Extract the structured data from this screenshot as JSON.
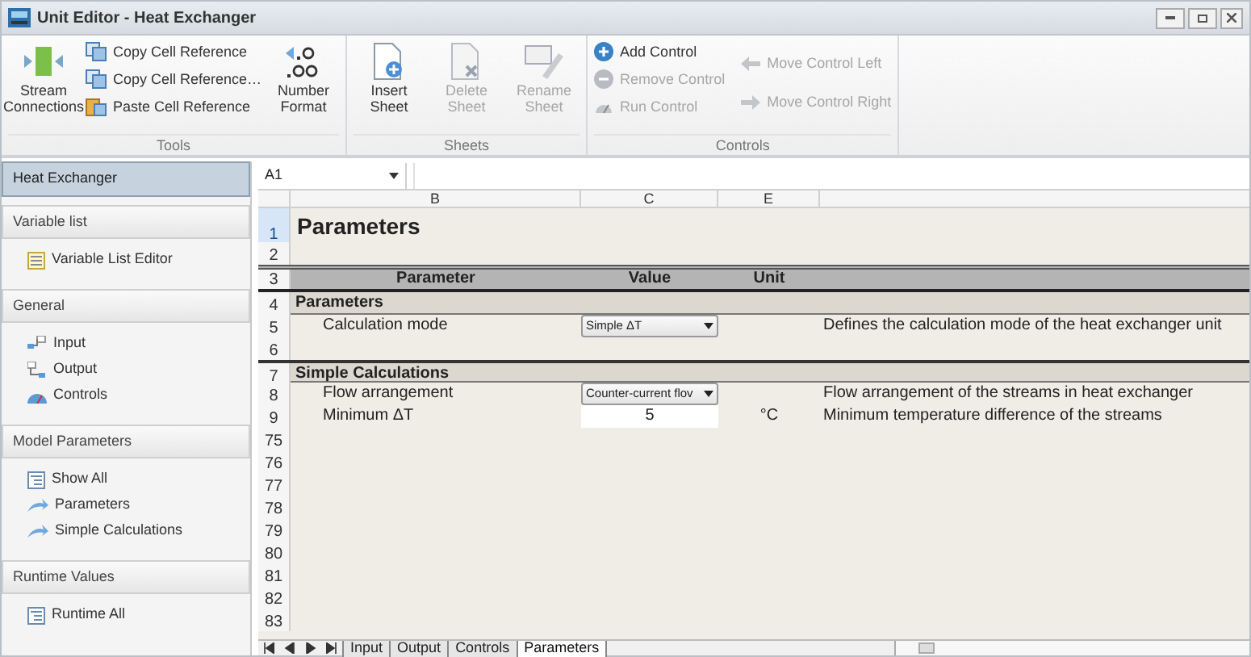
{
  "window": {
    "title": "Unit Editor - Heat Exchanger"
  },
  "ribbon": {
    "groups": [
      {
        "label": "Tools",
        "items": [
          {
            "label": "Stream Connections",
            "kind": "large",
            "disabled": false
          },
          {
            "label": "Copy Cell Reference",
            "kind": "small",
            "disabled": false
          },
          {
            "label": "Copy Cell Reference…",
            "kind": "small",
            "disabled": false
          },
          {
            "label": "Paste Cell Reference",
            "kind": "small",
            "disabled": false
          },
          {
            "label": "Number Format",
            "kind": "large",
            "disabled": false
          }
        ]
      },
      {
        "label": "Sheets",
        "items": [
          {
            "label": "Insert Sheet",
            "kind": "large",
            "disabled": false
          },
          {
            "label": "Delete Sheet",
            "kind": "large",
            "disabled": true
          },
          {
            "label": "Rename Sheet",
            "kind": "large",
            "disabled": true
          }
        ]
      },
      {
        "label": "Controls",
        "items": [
          {
            "label": "Add Control",
            "kind": "small",
            "disabled": false
          },
          {
            "label": "Remove Control",
            "kind": "small",
            "disabled": true
          },
          {
            "label": "Run Control",
            "kind": "small",
            "disabled": true
          },
          {
            "label": "Move Control Left",
            "kind": "small",
            "disabled": true
          },
          {
            "label": "Move Control Right",
            "kind": "small",
            "disabled": true
          }
        ]
      }
    ]
  },
  "sidebar": {
    "header": {
      "label": "Heat Exchanger",
      "selected": true
    },
    "sections": [
      {
        "title": "Variable list",
        "items": [
          {
            "label": "Variable List Editor"
          }
        ]
      },
      {
        "title": "General",
        "items": [
          {
            "label": "Input"
          },
          {
            "label": "Output"
          },
          {
            "label": "Controls"
          }
        ]
      },
      {
        "title": "Model Parameters",
        "items": [
          {
            "label": "Show All"
          },
          {
            "label": "Parameters"
          },
          {
            "label": "Simple Calculations"
          }
        ]
      },
      {
        "title": "Runtime Values",
        "items": [
          {
            "label": "Runtime All"
          }
        ]
      }
    ]
  },
  "sheet": {
    "name_box": "A1",
    "columns": [
      "B",
      "C",
      "E"
    ],
    "rows": [
      {
        "num": "1",
        "kind": "title",
        "selected": true,
        "text": "Parameters"
      },
      {
        "num": "2",
        "kind": "blank",
        "selected": false
      },
      {
        "num": "3",
        "kind": "header",
        "selected": false,
        "cells": [
          "Parameter",
          "Value",
          "Unit"
        ]
      },
      {
        "num": "4",
        "kind": "section",
        "selected": false,
        "text": "Parameters"
      },
      {
        "num": "5",
        "kind": "param",
        "selected": false,
        "name": "Calculation mode",
        "field": {
          "kind": "dropdown",
          "value": "Simple ΔT"
        },
        "description": "Defines the calculation mode of the heat exchanger unit"
      },
      {
        "num": "6",
        "kind": "blank",
        "selected": false
      },
      {
        "num": "7",
        "kind": "section",
        "selected": false,
        "text": "Simple Calculations"
      },
      {
        "num": "8",
        "kind": "param",
        "selected": false,
        "name": "Flow arrangement",
        "field": {
          "kind": "dropdown",
          "value": "Counter-current flov"
        },
        "description": "Flow arrangement of the streams in heat exchanger"
      },
      {
        "num": "9",
        "kind": "param",
        "selected": false,
        "name": "Minimum ΔT",
        "field": {
          "kind": "input",
          "value": "5"
        },
        "unit": "°C",
        "description": "Minimum temperature difference of the streams"
      },
      {
        "num": "75",
        "kind": "blank",
        "selected": false
      },
      {
        "num": "76",
        "kind": "blank",
        "selected": false
      },
      {
        "num": "77",
        "kind": "blank",
        "selected": false
      },
      {
        "num": "78",
        "kind": "blank",
        "selected": false
      },
      {
        "num": "79",
        "kind": "blank",
        "selected": false
      },
      {
        "num": "80",
        "kind": "blank",
        "selected": false
      },
      {
        "num": "81",
        "kind": "blank",
        "selected": false
      },
      {
        "num": "82",
        "kind": "blank",
        "selected": false
      },
      {
        "num": "83",
        "kind": "blank",
        "selected": false
      }
    ],
    "tabs": [
      {
        "label": "Input",
        "selected": false
      },
      {
        "label": "Output",
        "selected": false
      },
      {
        "label": "Controls",
        "selected": false
      },
      {
        "label": "Parameters",
        "selected": true
      }
    ]
  }
}
